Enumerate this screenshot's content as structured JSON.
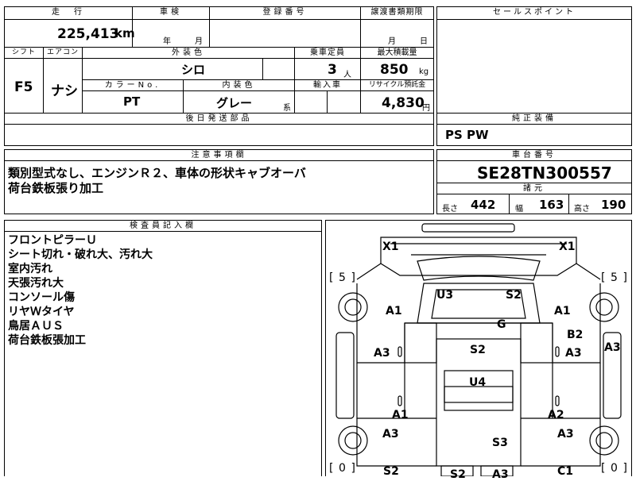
{
  "top_row": {
    "mileage_label": "走　行",
    "mileage_value": "225,413",
    "mileage_unit": "km",
    "inspection_label": "車検",
    "inspection_year": "年",
    "inspection_month": "月",
    "registration_label": "登録番号",
    "transfer_label": "譲渡書類期限",
    "transfer_month": "月",
    "transfer_day": "日",
    "sales_point_label": "セールスポイント"
  },
  "mid_row": {
    "shift_label": "シフト",
    "shift_value": "F5",
    "aircon_label": "エアコン",
    "aircon_value": "ナシ",
    "exterior_color_label": "外装色",
    "exterior_color_value": "シロ",
    "color_no_label": "カラーNo.",
    "color_no_value": "PT",
    "interior_color_label": "内装色",
    "interior_color_value": "グレー",
    "interior_suffix": "系",
    "capacity_label": "乗車定員",
    "capacity_value": "3",
    "capacity_unit": "人",
    "max_load_label": "最大積載量",
    "max_load_value": "850",
    "max_load_unit": "kg",
    "import_label": "輸入車",
    "recycle_label": "リサイクル預託金",
    "recycle_value": "4,830",
    "recycle_unit": "円",
    "later_parts_label": "後日発送部品",
    "genuine_equipment_label": "純正装備",
    "genuine_equipment_value": "PS PW"
  },
  "notes": {
    "label": "注意事項欄",
    "lines": [
      "類別型式なし、エンジンＲ２、車体の形状キャブオーバ",
      "荷台鉄板張り加工"
    ]
  },
  "chassis": {
    "label": "車台番号",
    "value": "SE28TN300557",
    "specs_label": "諸元",
    "length_label": "長さ",
    "length_value": "442",
    "width_label": "幅",
    "width_value": "163",
    "height_label": "高さ",
    "height_value": "190"
  },
  "inspector": {
    "label": "検査員記入欄",
    "lines": [
      "フロントピラーＵ",
      "シート切れ・破れ大、汚れ大",
      "室内汚れ",
      "天張汚れ大",
      "コンソール傷",
      "リヤＷタイヤ",
      "鳥居ＡＵＳ",
      "荷台鉄板張加工"
    ]
  },
  "diagram": {
    "tire_left_top": "5",
    "tire_right_top": "5",
    "tire_left_bottom": "0",
    "tire_right_bottom": "0",
    "marks": {
      "x1_left": "X1",
      "x1_right": "X1",
      "u3": "U3",
      "s2_roof": "S2",
      "a1_left": "A1",
      "a1_right": "A1",
      "g": "G",
      "b2": "B2",
      "a3_left_door": "A3",
      "s2_mid": "S2",
      "a3_right_door": "A3",
      "a3_right_edge": "A3",
      "u4": "U4",
      "a1_left_low": "A1",
      "a2_right_low": "A2",
      "a3_left_rear": "A3",
      "a3_right_rear": "A3",
      "s3": "S3",
      "s2_bottom_left": "S2",
      "s2_bottom_mid": "S2",
      "a3_bottom_mid": "A3",
      "c1_bottom_right": "C1"
    }
  }
}
